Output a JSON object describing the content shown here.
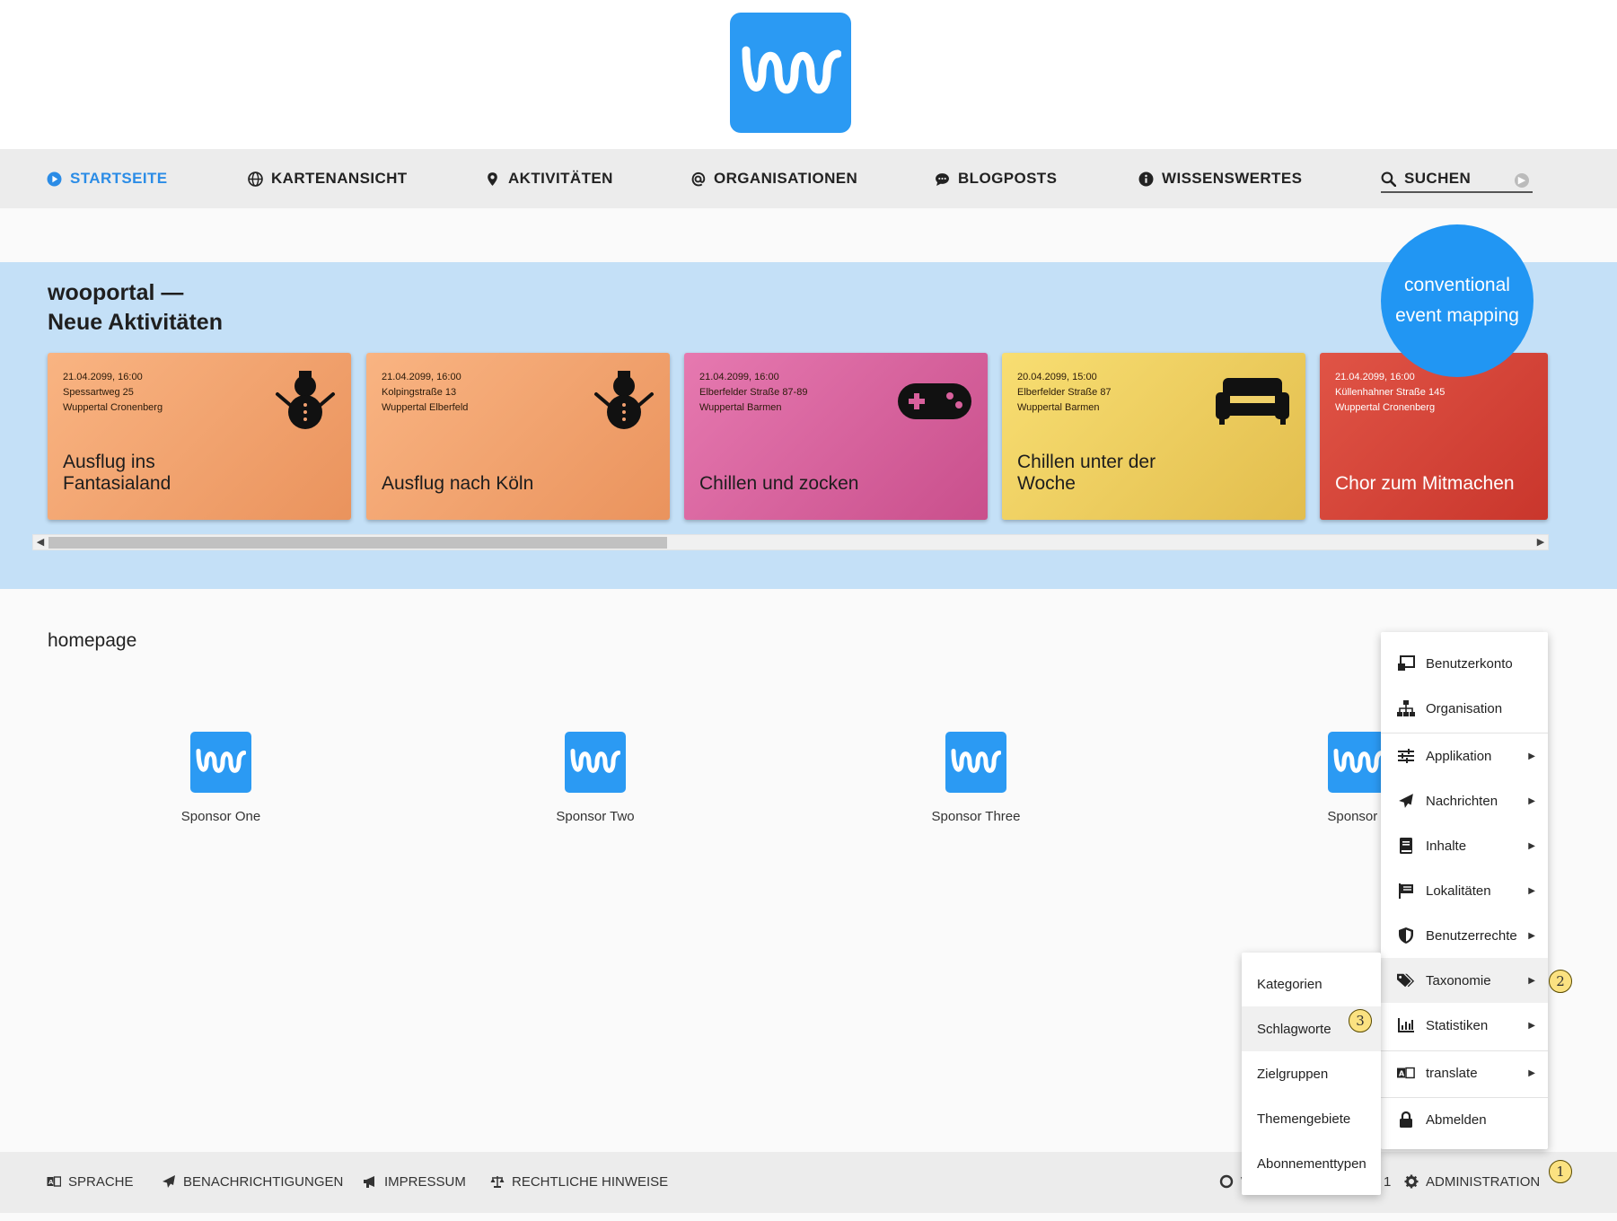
{
  "nav": {
    "home": "STARTSEITE",
    "map": "KARTENANSICHT",
    "activities": "AKTIVITÄTEN",
    "organisations": "ORGANISATIONEN",
    "blog": "BLOGPOSTS",
    "info": "WISSENSWERTES",
    "search": "SUCHEN"
  },
  "band": {
    "title_line1": "wooportal —",
    "title_line2": "Neue Aktivitäten",
    "badge_line1": "conventional",
    "badge_line2": "event mapping"
  },
  "cards": [
    {
      "date": "21.04.2099, 16:00",
      "street": "Spessartweg 25",
      "city": "Wuppertal Cronenberg",
      "title": "Ausflug ins Fantasialand",
      "icon": "snowman-icon",
      "color": "#f4a46a"
    },
    {
      "date": "21.04.2099, 16:00",
      "street": "Kolpingstraße 13",
      "city": "Wuppertal Elberfeld",
      "title": "Ausflug nach Köln",
      "icon": "snowman-icon",
      "color": "#f4a46a"
    },
    {
      "date": "21.04.2099, 16:00",
      "street": "Elberfelder Straße 87-89",
      "city": "Wuppertal Barmen",
      "title": "Chillen und zocken",
      "icon": "gamepad-icon",
      "color": "#d9609c"
    },
    {
      "date": "20.04.2099, 15:00",
      "street": "Elberfelder Straße 87",
      "city": "Wuppertal Barmen",
      "title": "Chillen unter der Woche",
      "icon": "sofa-icon",
      "color": "#f2cf5b"
    },
    {
      "date": "21.04.2099, 16:00",
      "street": "Küllenhahner Straße 145",
      "city": "Wuppertal Cronenberg",
      "title": "Chor zum Mitmachen",
      "icon": "",
      "color": "#d9473b"
    }
  ],
  "homepage": {
    "label": "homepage",
    "sponsors": [
      "Sponsor One",
      "Sponsor Two",
      "Sponsor Three",
      "Sponsor F"
    ]
  },
  "admin_menu": [
    {
      "label": "Benutzerkonto",
      "icon": "account-icon",
      "arrow": false
    },
    {
      "label": "Organisation",
      "icon": "sitemap-icon",
      "arrow": false
    },
    {
      "label": "Applikation",
      "icon": "sliders-icon",
      "arrow": true
    },
    {
      "label": "Nachrichten",
      "icon": "paper-plane-icon",
      "arrow": true
    },
    {
      "label": "Inhalte",
      "icon": "book-icon",
      "arrow": true
    },
    {
      "label": "Lokalitäten",
      "icon": "flag-icon",
      "arrow": true
    },
    {
      "label": "Benutzerrechte",
      "icon": "shield-icon",
      "arrow": true
    },
    {
      "label": "Taxonomie",
      "icon": "tags-icon",
      "arrow": true
    },
    {
      "label": "Statistiken",
      "icon": "bar-chart-icon",
      "arrow": true
    },
    {
      "label": "translate",
      "icon": "translate-icon",
      "arrow": true
    },
    {
      "label": "Abmelden",
      "icon": "lock-icon",
      "arrow": false
    }
  ],
  "taxonomy_menu": [
    "Kategorien",
    "Schlagworte",
    "Zielgruppen",
    "Themengebiete",
    "Abonnementtypen"
  ],
  "footer": {
    "language": "SPRACHE",
    "notifications": "BENACHRICHTIGUNGEN",
    "imprint": "IMPRESSUM",
    "legal": "RECHTLICHE HINWEISE",
    "partial_left": "W",
    "partial_right": "1",
    "admin": "ADMINISTRATION"
  },
  "step_badges": [
    "1",
    "2",
    "3"
  ]
}
